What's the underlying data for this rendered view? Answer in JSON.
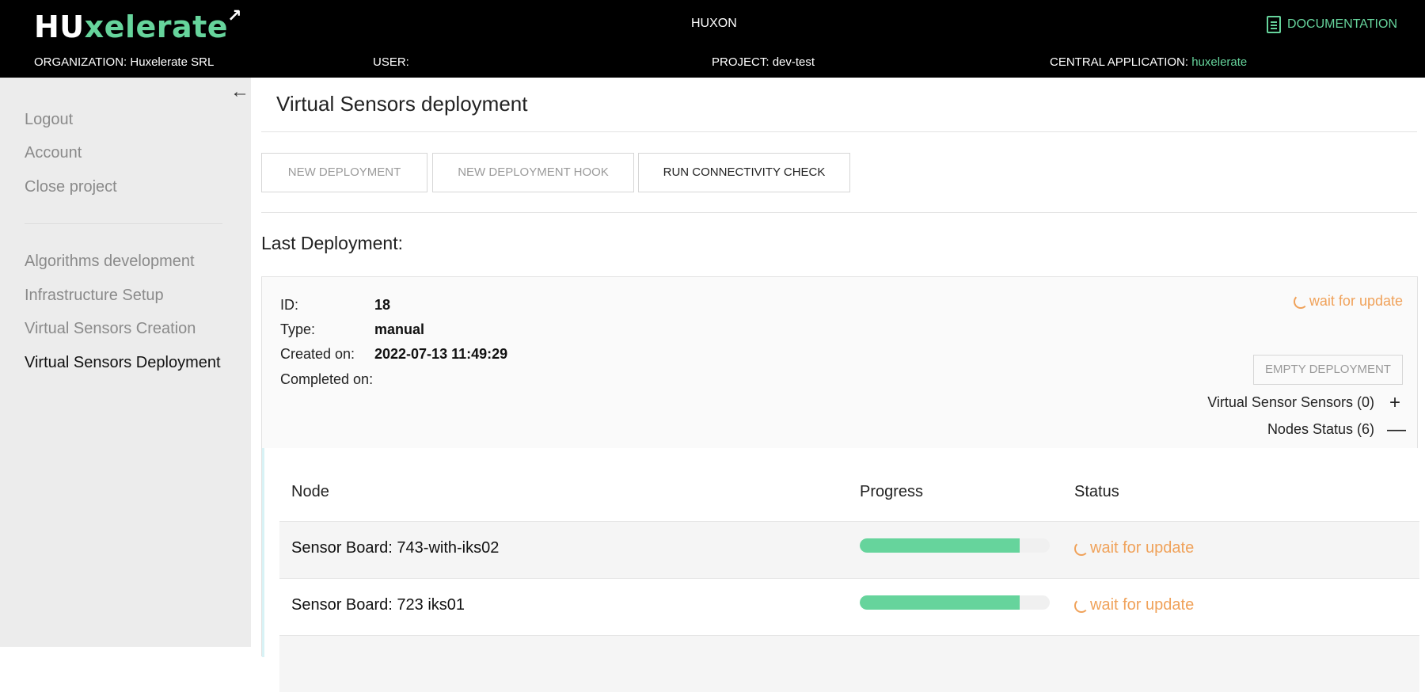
{
  "header": {
    "logo_hu": "HU",
    "logo_rest": "xelerate",
    "app_name": "HUXON",
    "documentation": "DOCUMENTATION",
    "organization_label": "ORGANIZATION:",
    "organization_value": "Huxelerate SRL",
    "user_label": "USER:",
    "user_value": "",
    "project_label": "PROJECT:",
    "project_value": "dev-test",
    "central_label": "CENTRAL APPLICATION:",
    "central_value": "huxelerate"
  },
  "sidebar": {
    "top_items": [
      "Logout",
      "Account",
      "Close project"
    ],
    "nav_items": [
      "Algorithms development",
      "Infrastructure Setup",
      "Virtual Sensors Creation",
      "Virtual Sensors Deployment"
    ],
    "active": "Virtual Sensors Deployment"
  },
  "main": {
    "title": "Virtual Sensors deployment",
    "buttons": {
      "new_deployment": "NEW DEPLOYMENT",
      "new_hook": "NEW DEPLOYMENT HOOK",
      "connectivity": "RUN CONNECTIVITY CHECK"
    },
    "last_deployment_label": "Last Deployment:",
    "deployment": {
      "id_label": "ID:",
      "id_value": "18",
      "type_label": "Type:",
      "type_value": "manual",
      "created_label": "Created on:",
      "created_value": "2022-07-13 11:49:29",
      "completed_label": "Completed on:",
      "completed_value": "",
      "status": "wait for update",
      "empty_button": "EMPTY DEPLOYMENT",
      "sensors_toggle": "Virtual Sensor Sensors (0)",
      "sensors_sign": "+",
      "nodes_toggle": "Nodes Status (6)",
      "nodes_sign": "—"
    },
    "table": {
      "columns": [
        "Node",
        "Progress",
        "Status"
      ],
      "rows": [
        {
          "node": "Sensor Board: 743-with-iks02",
          "progress": 0.84,
          "status": "wait for update"
        },
        {
          "node": "Sensor Board: 723 iks01",
          "progress": 0.84,
          "status": "wait for update"
        }
      ]
    }
  },
  "colors": {
    "accent": "#66d49c",
    "warning": "#f0a25a",
    "header_bg": "#000000",
    "sidebar_bg": "#ececec"
  }
}
